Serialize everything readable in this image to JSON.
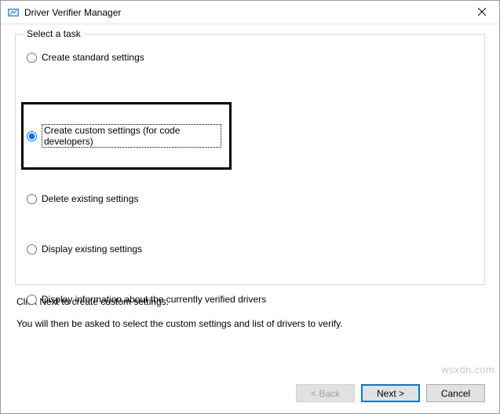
{
  "titlebar": {
    "title": "Driver Verifier Manager"
  },
  "group": {
    "legend": "Select a task"
  },
  "options": {
    "standard": "Create standard settings",
    "custom": "Create custom settings (for code developers)",
    "delete": "Delete existing settings",
    "display_settings": "Display existing settings",
    "display_info": "Display information about the currently verified drivers"
  },
  "hints": {
    "line1": "Click Next to create custom settings.",
    "line2": "You will then be asked to select the custom settings and list of drivers to verify."
  },
  "buttons": {
    "back": "< Back",
    "next": "Next >",
    "cancel": "Cancel"
  },
  "watermark": "wsxdn.com"
}
